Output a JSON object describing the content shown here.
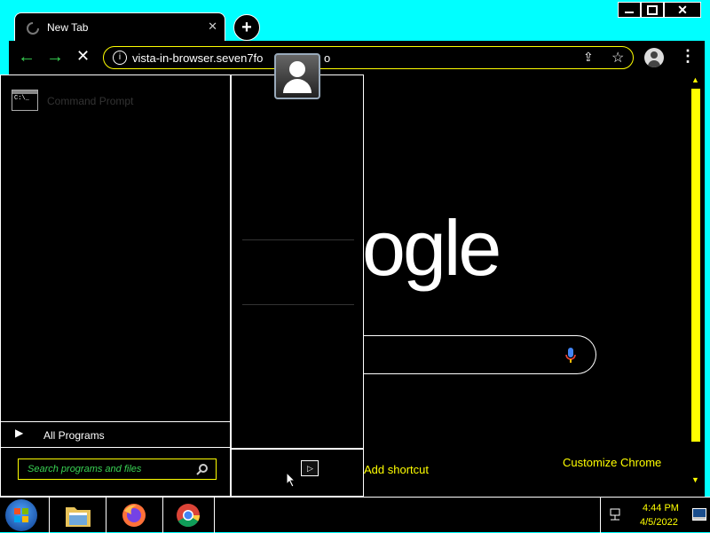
{
  "browser": {
    "tab_title": "New Tab",
    "url": "vista-in-browser.seven7fo",
    "url_tail": "o",
    "window_controls": [
      "minimize-icon",
      "maximize-icon",
      "close-icon"
    ]
  },
  "newtab": {
    "logo_fragment": "ogle",
    "add_shortcut": "Add shortcut",
    "customize": "Customize Chrome"
  },
  "start_menu": {
    "program": "Command Prompt",
    "all_programs": "All Programs",
    "search_placeholder": "Search programs and files"
  },
  "taskbar": {
    "time": "4:44 PM",
    "date": "4/5/2022",
    "apps": [
      "file-explorer-icon",
      "firefox-icon",
      "chrome-icon"
    ]
  },
  "colors": {
    "accent": "#00ffff",
    "highlight": "#ffff00",
    "nav": "#39d353"
  }
}
